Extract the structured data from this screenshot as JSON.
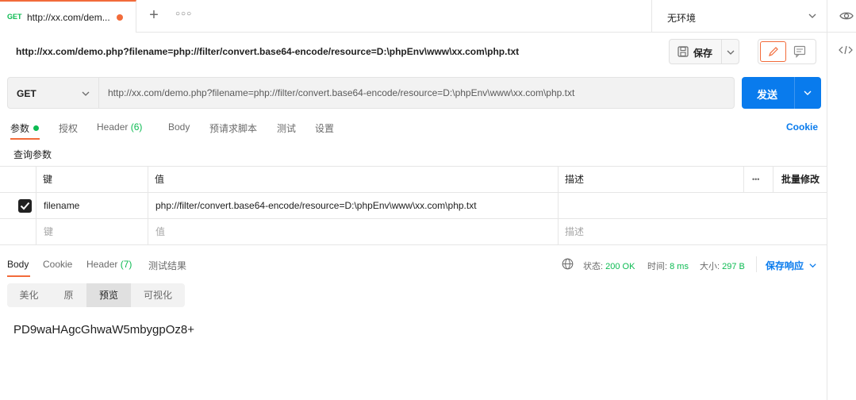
{
  "tab": {
    "method": "GET",
    "title": "http://xx.com/dem..."
  },
  "env": {
    "label": "无环境"
  },
  "request": {
    "name": "http://xx.com/demo.php?filename=php://filter/convert.base64-encode/resource=D:\\phpEnv\\www\\xx.com\\php.txt",
    "save_label": "保存",
    "method": "GET",
    "url": "http://xx.com/demo.php?filename=php://filter/convert.base64-encode/resource=D:\\phpEnv\\www\\xx.com\\php.txt",
    "send_label": "发送"
  },
  "req_tabs": {
    "params": "参数",
    "auth": "授权",
    "header": "Header",
    "header_count": "(6)",
    "body": "Body",
    "prerequest": "预请求脚本",
    "tests": "测试",
    "settings": "设置",
    "cookie": "Cookie"
  },
  "query": {
    "title": "查询参数",
    "headers": {
      "key": "键",
      "value": "值",
      "desc": "描述",
      "more": "•••",
      "bulk": "批量修改"
    },
    "rows": [
      {
        "key": "filename",
        "value": "php://filter/convert.base64-encode/resource=D:\\phpEnv\\www\\xx.com\\php.txt",
        "desc": ""
      }
    ],
    "placeholder": {
      "key": "键",
      "value": "值",
      "desc": "描述"
    }
  },
  "response": {
    "tabs": {
      "body": "Body",
      "cookie": "Cookie",
      "header": "Header",
      "header_count": "(7)",
      "tests": "测试结果"
    },
    "status_label": "状态:",
    "status_value": "200 OK",
    "time_label": "时间:",
    "time_value": "8 ms",
    "size_label": "大小:",
    "size_value": "297 B",
    "save_label": "保存响应",
    "modes": [
      "美化",
      "原",
      "预览",
      "可视化"
    ],
    "active_mode": "预览",
    "content": "PD9waHAgcGhwaW5mbygpOz8+"
  },
  "colors": {
    "accent": "#f26b3a",
    "primary": "#097bed",
    "success": "#0cbb52"
  }
}
